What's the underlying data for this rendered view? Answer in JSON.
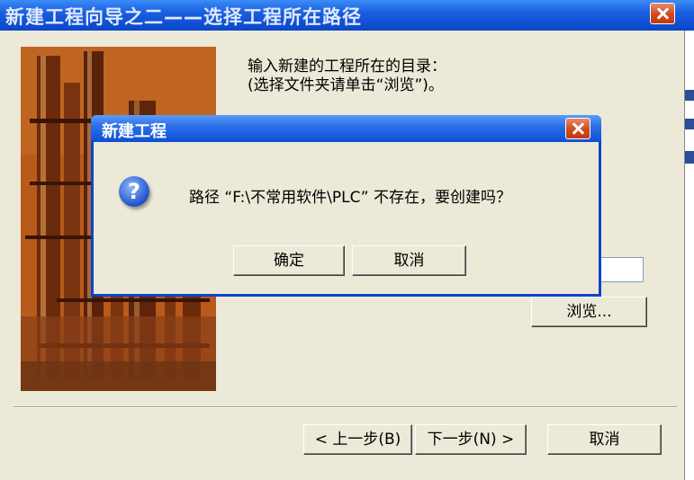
{
  "wizard": {
    "title": "新建工程向导之二——选择工程所在路径",
    "instruction_line1": "输入新建的工程所在的目录：",
    "instruction_line2": "(选择文件夹请单击“浏览”)。",
    "browse_label": "浏览...",
    "back_label": "< 上一步(B)",
    "next_label": "下一步(N) >",
    "cancel_label": "取消",
    "path_value": ""
  },
  "dialog": {
    "title": "新建工程",
    "message": "路径 “F:\\不常用软件\\PLC” 不存在，要创建吗？",
    "ok_label": "确定",
    "cancel_label": "取消"
  },
  "icons": {
    "wizard_close": "close-icon",
    "dialog_close": "close-icon",
    "question": "question-icon"
  },
  "colors": {
    "title_bar": "#0a46c8",
    "window_bg": "#ece9d8",
    "close_button": "#d24a1c",
    "image_tone": "#b85718"
  }
}
